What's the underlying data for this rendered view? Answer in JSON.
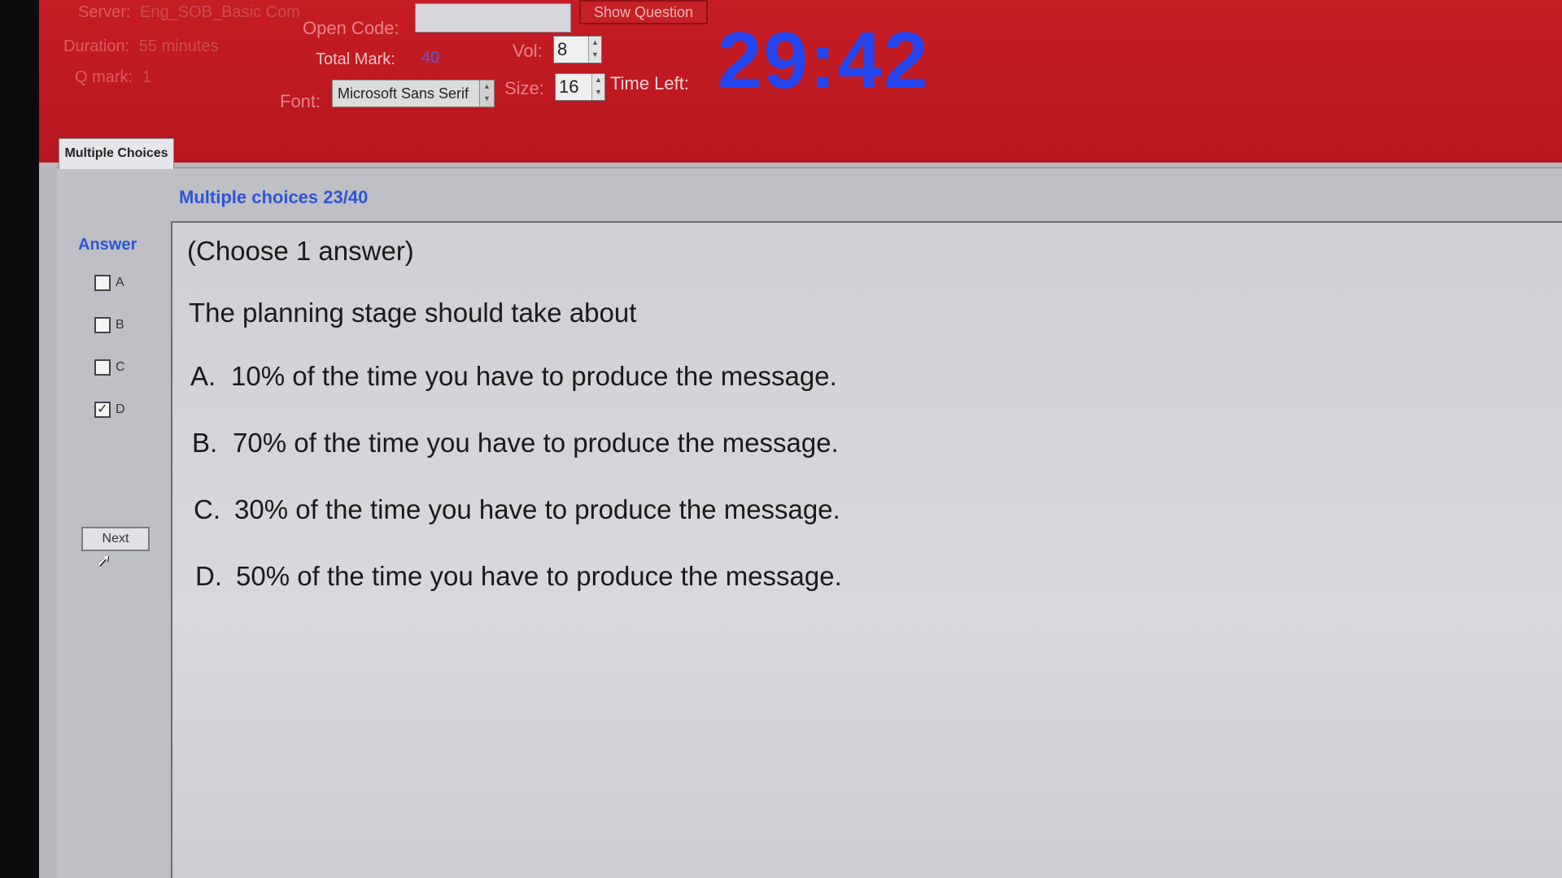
{
  "header": {
    "server_label": "Server:",
    "server_value": "Eng_SOB_Basic Com",
    "duration_label": "Duration:",
    "duration_value": "55 minutes",
    "qmark_label": "Q mark:",
    "qmark_value": "1",
    "open_code_label": "Open Code:",
    "open_code_value": "",
    "show_question_label": "Show Question",
    "total_mark_label": "Total Mark:",
    "total_mark_value": "40",
    "vol_label": "Vol:",
    "vol_value": "8",
    "font_label": "Font:",
    "font_value": "Microsoft Sans Serif",
    "size_label": "Size:",
    "size_value": "16",
    "time_left_label": "Time Left:",
    "time_left_value": "29:42"
  },
  "tab": {
    "label": "Multiple Choices"
  },
  "section": {
    "title": "Multiple choices 23/40"
  },
  "sidebar": {
    "answer_label": "Answer",
    "options": [
      {
        "label": "A",
        "checked": false
      },
      {
        "label": "B",
        "checked": false
      },
      {
        "label": "C",
        "checked": false
      },
      {
        "label": "D",
        "checked": true
      }
    ],
    "next_label": "Next"
  },
  "question": {
    "instruction": "(Choose 1 answer)",
    "stem": "The planning stage should take about",
    "choices": [
      {
        "letter": "A.",
        "text": "10% of the time you have to produce the message."
      },
      {
        "letter": "B.",
        "text": "70% of the time you have to produce the message."
      },
      {
        "letter": "C.",
        "text": "30% of the time you have to produce the message."
      },
      {
        "letter": "D.",
        "text": "50% of the time you have to produce the message."
      }
    ]
  },
  "colors": {
    "header_red": "#c61c24",
    "timer_blue": "#2345ef",
    "title_blue": "#2a55d6"
  }
}
